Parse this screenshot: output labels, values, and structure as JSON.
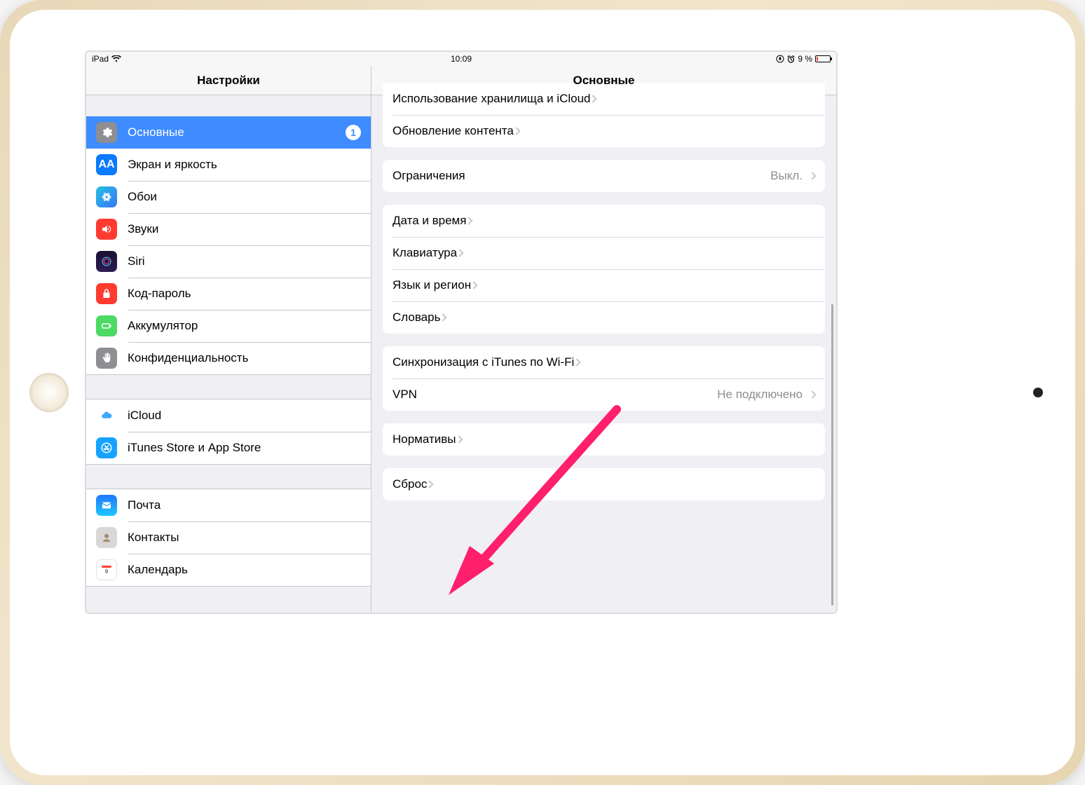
{
  "status": {
    "device": "iPad",
    "time": "10:09",
    "battery_text": "9 %",
    "battery_pct": 9
  },
  "sidebar": {
    "title": "Настройки",
    "group1": [
      {
        "label": "Основные",
        "badge": "1",
        "selected": true
      },
      {
        "label": "Экран и яркость"
      },
      {
        "label": "Обои"
      },
      {
        "label": "Звуки"
      },
      {
        "label": "Siri"
      },
      {
        "label": "Код-пароль"
      },
      {
        "label": "Аккумулятор"
      },
      {
        "label": "Конфиденциальность"
      }
    ],
    "group2": [
      {
        "label": "iCloud"
      },
      {
        "label": "iTunes Store и App Store"
      }
    ],
    "group3": [
      {
        "label": "Почта"
      },
      {
        "label": "Контакты"
      },
      {
        "label": "Календарь"
      }
    ]
  },
  "detail": {
    "title": "Основные",
    "groups": [
      {
        "rows": [
          {
            "label": "Использование хранилища и iCloud"
          },
          {
            "label": "Обновление контента"
          }
        ]
      },
      {
        "rows": [
          {
            "label": "Ограничения",
            "value": "Выкл."
          }
        ]
      },
      {
        "rows": [
          {
            "label": "Дата и время"
          },
          {
            "label": "Клавиатура"
          },
          {
            "label": "Язык и регион"
          },
          {
            "label": "Словарь"
          }
        ]
      },
      {
        "rows": [
          {
            "label": "Синхронизация с iTunes по Wi-Fi"
          },
          {
            "label": "VPN",
            "value": "Не подключено"
          }
        ]
      },
      {
        "rows": [
          {
            "label": "Нормативы"
          }
        ]
      },
      {
        "rows": [
          {
            "label": "Сброс"
          }
        ]
      }
    ]
  }
}
